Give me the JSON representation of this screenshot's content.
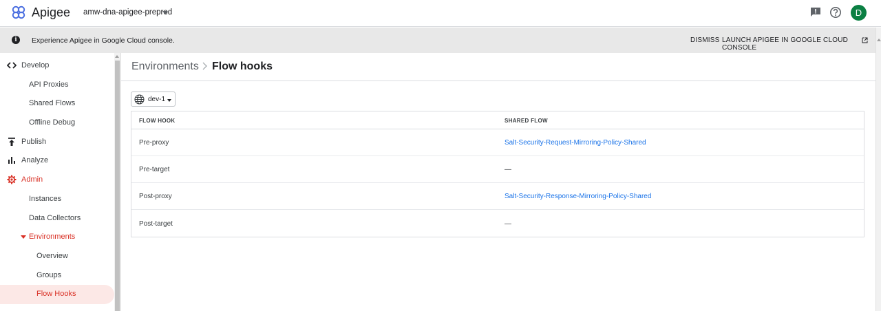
{
  "header": {
    "app_title": "Apigee",
    "org_name": "amw-dna-apigee-preprod",
    "avatar_initial": "D",
    "brand_color": "#4a6ee0",
    "avatar_color": "#0b8043"
  },
  "banner": {
    "info_icon": "info-icon",
    "text": "Experience Apigee in Google Cloud console.",
    "dismiss_label": "DISMISS",
    "launch_label": "LAUNCH APIGEE IN GOOGLE CLOUD CONSOLE"
  },
  "sidebar": {
    "develop": "Develop",
    "api_proxies": "API Proxies",
    "shared_flows": "Shared Flows",
    "offline_debug": "Offline Debug",
    "publish": "Publish",
    "analyze": "Analyze",
    "admin": "Admin",
    "instances": "Instances",
    "data_collectors": "Data Collectors",
    "environments": "Environments",
    "overview": "Overview",
    "groups": "Groups",
    "flow_hooks": "Flow Hooks",
    "accent_color": "#d93025"
  },
  "page": {
    "breadcrumb": "Environments",
    "title": "Flow hooks"
  },
  "env_select": {
    "value": "dev-1"
  },
  "table": {
    "col_hook": "FLOW HOOK",
    "col_flow": "SHARED FLOW",
    "rows": [
      {
        "hook": "Pre-proxy",
        "flow": "Salt-Security-Request-Mirroring-Policy-Shared"
      },
      {
        "hook": "Pre-target",
        "flow": "—"
      },
      {
        "hook": "Post-proxy",
        "flow": "Salt-Security-Response-Mirroring-Policy-Shared"
      },
      {
        "hook": "Post-target",
        "flow": "—"
      }
    ],
    "link_color": "#1a73e8"
  }
}
